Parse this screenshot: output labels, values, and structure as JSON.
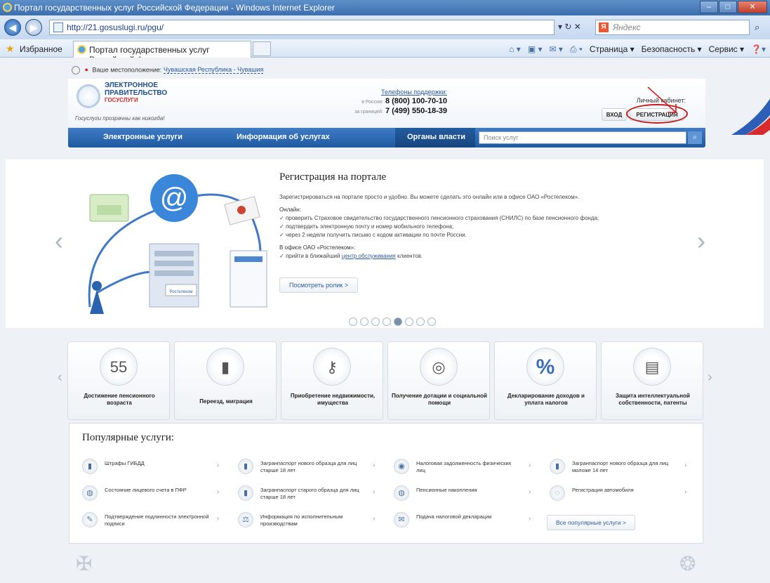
{
  "browser": {
    "title": "Портал государственных услуг Российской Федерации - Windows Internet Explorer",
    "url": "http://21.gosuslugi.ru/pgu/",
    "search_placeholder": "Яндекс",
    "favorites_label": "Избранное",
    "tab_title": "Портал государственных услуг Российской Фе...",
    "cmd_page": "Страница ▾",
    "cmd_security": "Безопасность ▾",
    "cmd_service": "Сервис ▾"
  },
  "location": {
    "label": "Ваше местоположение:",
    "region": "Чувашская Республика - Чувашия"
  },
  "header": {
    "logo_line1": "ЭЛЕКТРОННОЕ",
    "logo_line2": "ПРАВИТЕЛЬСТВО",
    "logo_line3": "ГОСУСЛУГИ",
    "slogan": "Госуслуги прозрачны как никогда!",
    "support_title": "Телефоны поддержки:",
    "phone_ru_label": "в России:",
    "phone_ru": "8 (800) 100-70-10",
    "phone_abroad_label": "за границей:",
    "phone_abroad": "7 (499) 550-18-39",
    "cabinet_label": "Личный кабинет:",
    "login": "ВХОД",
    "register": "РЕГИСТРАЦИЯ"
  },
  "menu": {
    "items": [
      "Электронные услуги",
      "Информация об услугах",
      "Органы власти"
    ],
    "search_placeholder": "Поиск услуг"
  },
  "slide": {
    "title": "Регистрация на портале",
    "intro": "Зарегистрироваться на портале просто и удобно. Вы можете сделать это онлайн или в офисе ОАО «Ростелеком».",
    "online_header": "Онлайн:",
    "online_items": [
      "проверить Страховое свидетельство государственного пенсионного страхования (СНИЛС) по базе пенсионного фонда;",
      "подтвердить электронную почту и номер мобильного телефона;",
      "через 2 недели получить письмо с кодом активации по почте России."
    ],
    "office_header": "В офисе ОАО «Ростелеком»:",
    "office_item_pre": "прийти в ближайший ",
    "office_item_link": "центр обслуживания",
    "office_item_post": " клиентов.",
    "video_button": "Посмотреть ролик  >",
    "illus_label": "Ростелеком"
  },
  "carousel": {
    "total": 8,
    "active_index": 4
  },
  "categories": [
    {
      "label": "Достижение пенсионного возраста",
      "icon": "55"
    },
    {
      "label": "Переезд, миграция",
      "icon": "passport-icon"
    },
    {
      "label": "Приобретение недвижимости, имущества",
      "icon": "keys-icon"
    },
    {
      "label": "Получение дотации и социальной помощи",
      "icon": "lifebuoy-icon"
    },
    {
      "label": "Декларирование доходов и уплата налогов",
      "icon": "%"
    },
    {
      "label": "Защита интеллектуальной собственности, патенты",
      "icon": "certificate-icon"
    }
  ],
  "popular": {
    "title": "Популярные услуги:",
    "items": [
      "Штрафы ГИБДД",
      "Загранпаспорт нового образца для лиц старше 18 лет",
      "Налоговая задолженность физических лиц",
      "Загранпаспорт нового образца для лиц моложе 14 лет",
      "Состояние лицевого счета в ПФР",
      "Загранпаспорт старого образца для лиц старше 18 лет",
      "Пенсионные накопления",
      "Регистрация автомобиля",
      "Подтверждение подлинности электронной подписи",
      "Информация по исполнительным производствам",
      "Подача налоговой декларации"
    ],
    "all_button": "Все популярные услуги  >"
  }
}
